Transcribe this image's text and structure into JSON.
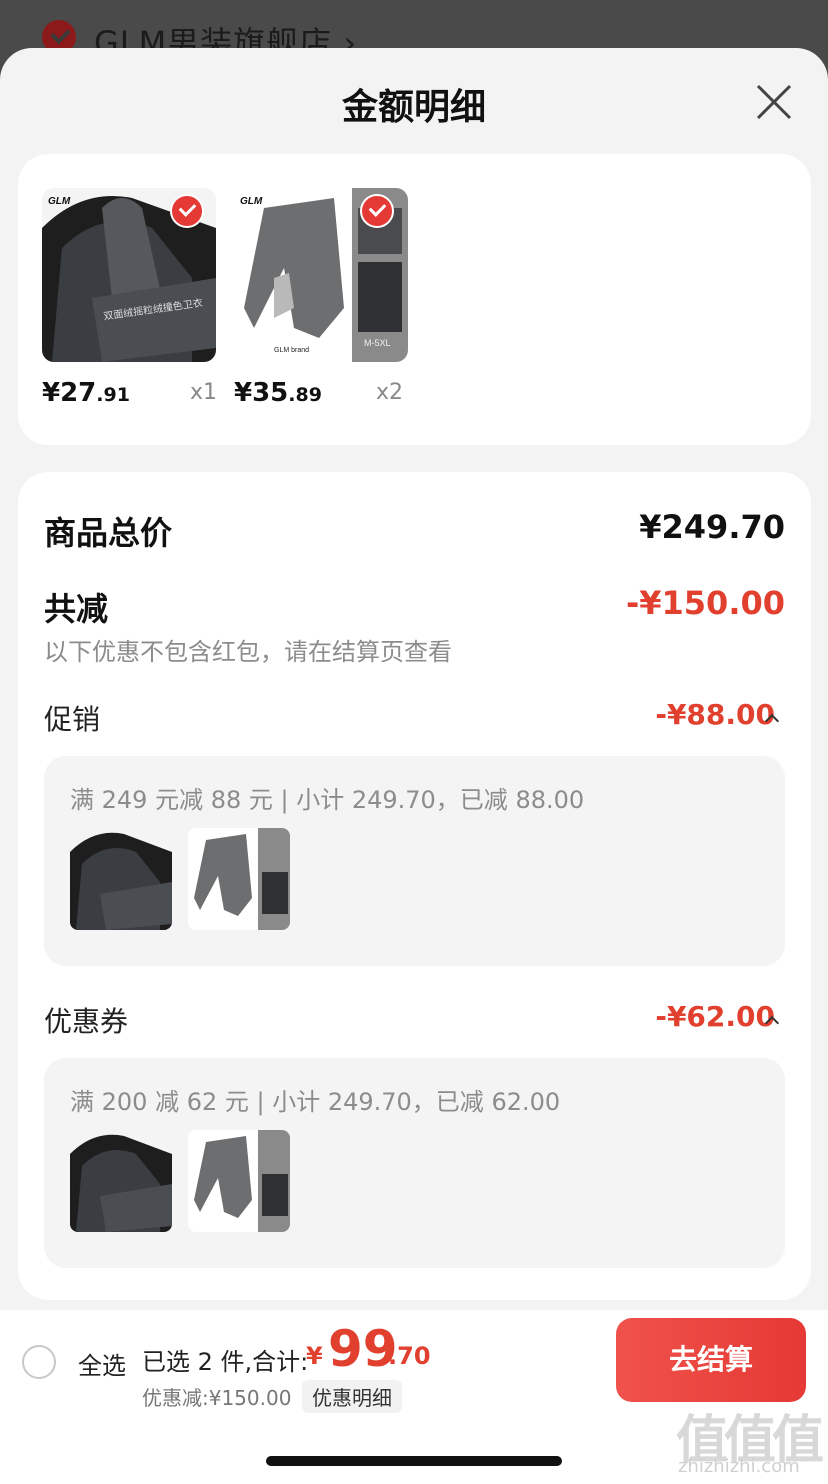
{
  "store": {
    "name": "GLM男装旗舰店",
    "chevron": "›"
  },
  "sheet": {
    "title": "金额明细"
  },
  "products": [
    {
      "price_int": "¥27",
      "price_dec": ".91",
      "qty": "x1",
      "img_text": "双面绒摇粒绒撞色卫衣",
      "brand": "GLM",
      "selected": true
    },
    {
      "price_int": "¥35",
      "price_dec": ".89",
      "qty": "x2",
      "brand": "GLM",
      "brand_sub": "GLM brand",
      "size_text": "M-5XL",
      "selected": true
    }
  ],
  "breakdown": {
    "total_label": "商品总价",
    "total_value": "¥249.70",
    "reduce_label": "共减",
    "reduce_value": "-¥150.00",
    "hint": "以下优惠不包含红包，请在结算页查看",
    "promotion": {
      "label": "促销",
      "value": "-¥88.00",
      "detail": "满 249 元减 88 元 | 小计 249.70，已减 88.00"
    },
    "coupon": {
      "label": "优惠券",
      "value": "-¥62.00",
      "detail": "满 200 减 62 元 | 小计 249.70，已减 62.00"
    }
  },
  "bottom_bar": {
    "select_all": "全选",
    "selected_summary": "已选 2 件,合计:",
    "total_currency": "¥",
    "total_int": "99",
    "total_dec": ".70",
    "discount": "优惠减:¥150.00",
    "detail_link": "优惠明细",
    "checkout": "去结算"
  },
  "watermark": {
    "logo": "值值值",
    "url": "zhizhizhi.com"
  },
  "colors": {
    "accent": "#e1402f",
    "button": "#e53935",
    "sheet_bg": "#f3f3f3"
  }
}
